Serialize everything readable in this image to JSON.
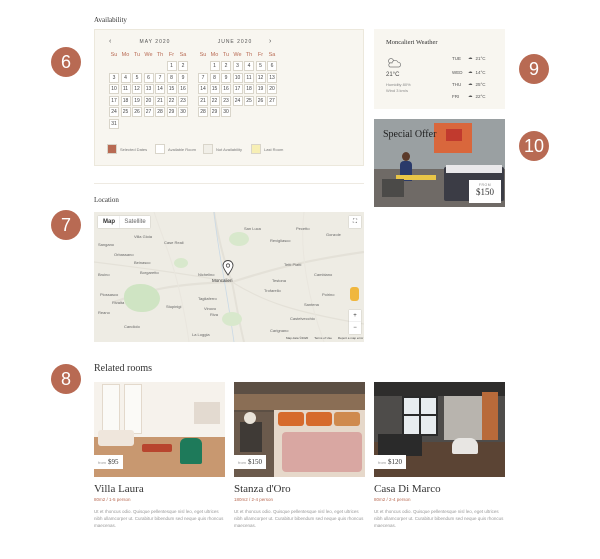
{
  "markers": [
    "6",
    "7",
    "8",
    "9",
    "10"
  ],
  "availability": {
    "title": "Availability",
    "month_left": "MAY 2020",
    "month_right": "JUNE 2020",
    "dow": [
      "Su",
      "Mo",
      "Tu",
      "We",
      "Th",
      "Fr",
      "Sa"
    ],
    "may_rows": [
      [
        "",
        "",
        "",
        "",
        "",
        "1",
        "2"
      ],
      [
        "3",
        "4",
        "5",
        "6",
        "7",
        "8",
        "9"
      ],
      [
        "10",
        "11",
        "12",
        "13",
        "14",
        "15",
        "16"
      ],
      [
        "17",
        "18",
        "19",
        "20",
        "21",
        "22",
        "23"
      ],
      [
        "24",
        "25",
        "26",
        "27",
        "28",
        "29",
        "30"
      ],
      [
        "31",
        "",
        "",
        "",
        "",
        "",
        ""
      ]
    ],
    "june_rows": [
      [
        "",
        "1",
        "2",
        "3",
        "4",
        "5",
        "6"
      ],
      [
        "7",
        "8",
        "9",
        "10",
        "11",
        "12",
        "13"
      ],
      [
        "14",
        "15",
        "16",
        "17",
        "18",
        "19",
        "20"
      ],
      [
        "21",
        "22",
        "23",
        "24",
        "25",
        "26",
        "27"
      ],
      [
        "28",
        "29",
        "30",
        "",
        "",
        "",
        ""
      ]
    ],
    "legend": [
      "Selected Dates",
      "Available Room",
      "Not Availability",
      "Last Room"
    ],
    "colors": {
      "selected": "#b86a53",
      "available": "#ffffff",
      "not_available": "#f1efe8",
      "last": "#f7efb5"
    }
  },
  "weather": {
    "title": "Moncalieri Weather",
    "temp": "21°C",
    "humidity": "Humidity 80%",
    "wind": "Wind 3 km/s",
    "forecast": [
      {
        "day": "TUE",
        "temp": "21°C"
      },
      {
        "day": "WED",
        "temp": "14°C"
      },
      {
        "day": "THU",
        "temp": "25°C"
      },
      {
        "day": "FRI",
        "temp": "22°C"
      }
    ]
  },
  "offer": {
    "title": "Special Offer",
    "from": "FROM",
    "price": "$150"
  },
  "location": {
    "title": "Location",
    "map_tab": "Map",
    "satellite_tab": "Satellite",
    "fullscreen": "⛶",
    "zoom_in": "+",
    "zoom_out": "−",
    "pin_label": "Moncalieri",
    "places": [
      "Villa Gioia",
      "Nichelino",
      "Trofarello",
      "Testona",
      "Candiolo",
      "Vinovo",
      "La Loggia",
      "Carignano",
      "Bruino",
      "Orbassano",
      "Stupinigi",
      "Beinasco",
      "Rivalta",
      "Piossasco",
      "Borgaretto",
      "Sangano",
      "Tetti Piatti",
      "Cambiano",
      "Santena",
      "Revigliasco",
      "Pecetto",
      "San Luca",
      "Reano",
      "Tagliaferro",
      "Riva",
      "Castelvecchio",
      "Gonzole",
      "Case Reali",
      "Poirino"
    ],
    "footer": [
      "Map data ©2020",
      "Terms of Use",
      "Report a map error"
    ]
  },
  "related": {
    "title": "Related rooms",
    "rooms": [
      {
        "name": "Villa Laura",
        "meta": "80m2 / 1-5 person",
        "from": "from",
        "price": "$95",
        "desc": "Ut et rhoncus odio. Quisque pellentesque nisl leo, eget ultrices nibh ullamcorper ut. Curabitur bibendum sed neque quis rhoncus maecenas."
      },
      {
        "name": "Stanza d'Oro",
        "meta": "180m2 / 2-4 person",
        "from": "from",
        "price": "$150",
        "desc": "Ut et rhoncus odio. Quisque pellentesque nisl leo, eget ultrices nibh ullamcorper ut. Curabitur bibendum sed neque quis rhoncus maecenas."
      },
      {
        "name": "Casa Di Marco",
        "meta": "80m2 / 2-4 person",
        "from": "from",
        "price": "$120",
        "desc": "Ut et rhoncus odio. Quisque pellentesque nisl leo, eget ultrices nibh ullamcorper ut. Curabitur bibendum sed neque quis rhoncus maecenas."
      }
    ]
  }
}
